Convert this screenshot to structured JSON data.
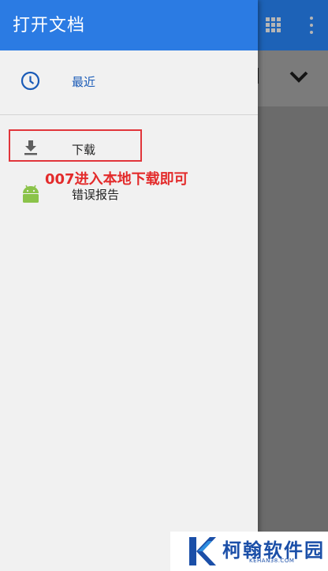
{
  "drawer": {
    "title": "打开文档",
    "items": [
      {
        "label": "最近",
        "icon": "clock-icon"
      },
      {
        "label": "下载",
        "icon": "download-icon"
      },
      {
        "label": "错误报告",
        "icon": "android-icon"
      }
    ]
  },
  "annotation": "007进入本地下载即可",
  "watermark": {
    "name": "柯翰软件园",
    "url": "KEHAN38.COM"
  },
  "colors": {
    "header": "#2b7be3",
    "accent": "#1a5bb7",
    "drawer_bg": "#f1f1f1",
    "annotation": "#e32b2b",
    "android": "#8bc34a"
  }
}
